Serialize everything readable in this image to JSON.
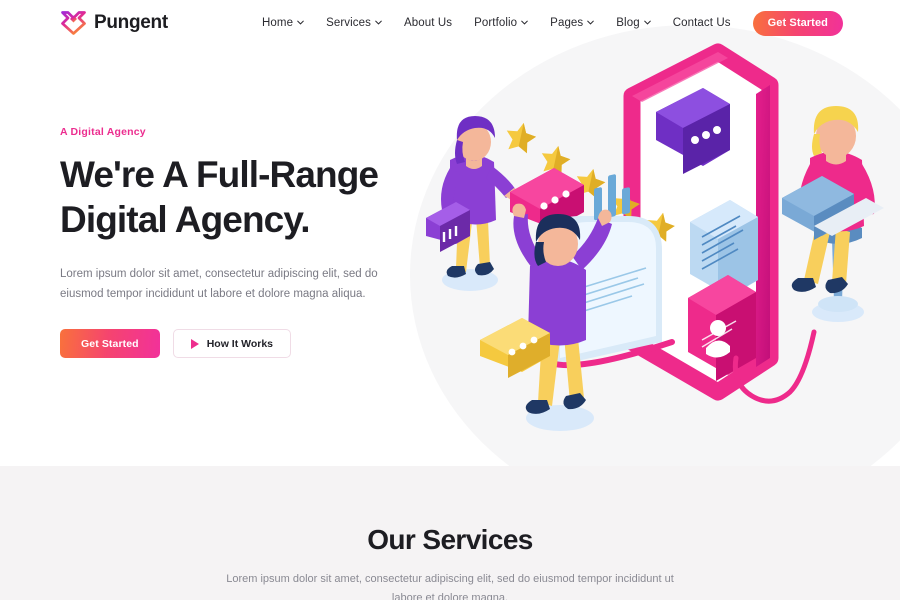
{
  "brand": {
    "name": "Pungent",
    "logo_icon": "butterfly-heart-logo-icon",
    "gradient_start": "#b12ad8",
    "gradient_end": "#f97a3a"
  },
  "header": {
    "nav_items": [
      {
        "label": "Home",
        "has_dropdown": true,
        "icon": "chevron-down-icon"
      },
      {
        "label": "Services",
        "has_dropdown": true,
        "icon": "chevron-down-icon"
      },
      {
        "label": "About Us",
        "has_dropdown": false,
        "icon": ""
      },
      {
        "label": "Portfolio",
        "has_dropdown": true,
        "icon": "chevron-down-icon"
      },
      {
        "label": "Pages",
        "has_dropdown": true,
        "icon": "chevron-down-icon"
      },
      {
        "label": "Blog",
        "has_dropdown": true,
        "icon": "chevron-down-icon"
      },
      {
        "label": "Contact Us",
        "has_dropdown": false,
        "icon": ""
      }
    ],
    "cta_label": "Get Started",
    "cta_gradient_start": "#f9713c",
    "cta_gradient_end": "#f2319a"
  },
  "hero": {
    "eyebrow": "A Digital Agency",
    "eyebrow_color": "#ec2d8f",
    "title_line1": "We're A Full-Range",
    "title_line2": "Digital Agency.",
    "description": "Lorem ipsum dolor sit amet, consectetur adipiscing elit, sed do eiusmod tempor incididunt ut labore et dolore magna aliqua.",
    "primary_button": "Get Started",
    "secondary_button": "How It Works",
    "secondary_button_icon": "play-icon",
    "illustration": {
      "name": "isometric-team-illustration",
      "background_circle_color": "#f6f6f7",
      "elements": [
        "woman-holding-pink-card",
        "five-gold-stars",
        "pink-isometric-phone",
        "purple-chat-bubble-card",
        "man-purple-shirt-at-dashboard",
        "yellow-message-card",
        "blue-text-document-card",
        "pink-profile-card",
        "man-pink-shirt-on-stool-with-laptop"
      ],
      "palette": {
        "pink": "#ee2a8b",
        "magenta": "#d9138a",
        "purple": "#8b3fd4",
        "yellow": "#f9cf5a",
        "light_blue": "#cfe4f7",
        "navy": "#1f3864"
      }
    }
  },
  "services": {
    "title": "Our Services",
    "description": "Lorem ipsum dolor sit amet, consectetur adipiscing elit, sed do eiusmod tempor incididunt ut labore et dolore magna.",
    "background_color": "#f5f3f4"
  }
}
